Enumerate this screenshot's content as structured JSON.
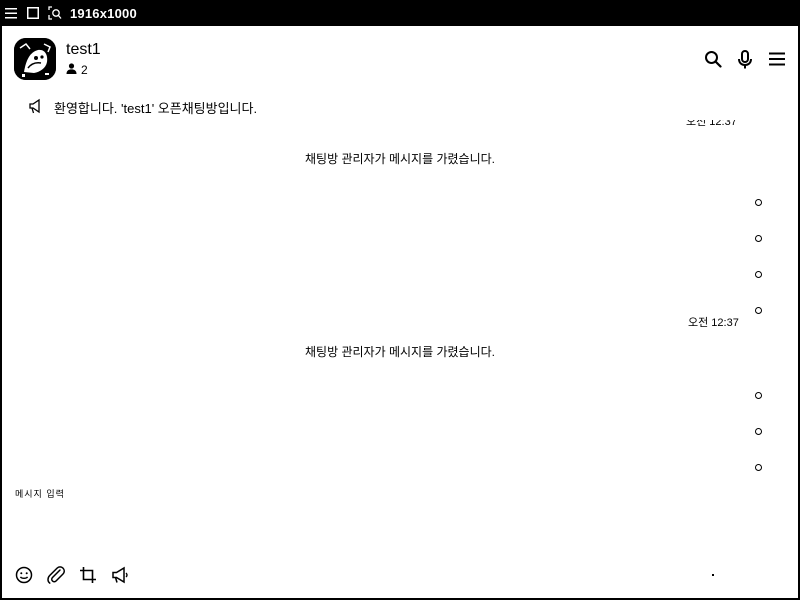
{
  "window": {
    "title": "1916x1000",
    "icons": [
      "menu-icon",
      "maximize-icon",
      "screen-capture-icon"
    ]
  },
  "header": {
    "room_name": "test1",
    "member_count": "2",
    "icons": [
      "search-icon",
      "microphone-icon",
      "menu-icon"
    ]
  },
  "notice": {
    "text": "환영합니다. 'test1' 오픈채팅방입니다."
  },
  "messages": [
    {
      "type": "time",
      "text": "오전 12:37",
      "partial": true
    },
    {
      "type": "system",
      "text": "채팅방 관리자가 메시지를 가렸습니다."
    },
    {
      "type": "time",
      "text": "오전 12:37"
    },
    {
      "type": "system",
      "text": "채팅방 관리자가 메시지를 가렸습니다."
    }
  ],
  "input": {
    "placeholder": "메시지 입력"
  },
  "toolbar": {
    "icons": [
      "emoji-icon",
      "attachment-icon",
      "crop-icon",
      "megaphone-icon"
    ]
  }
}
